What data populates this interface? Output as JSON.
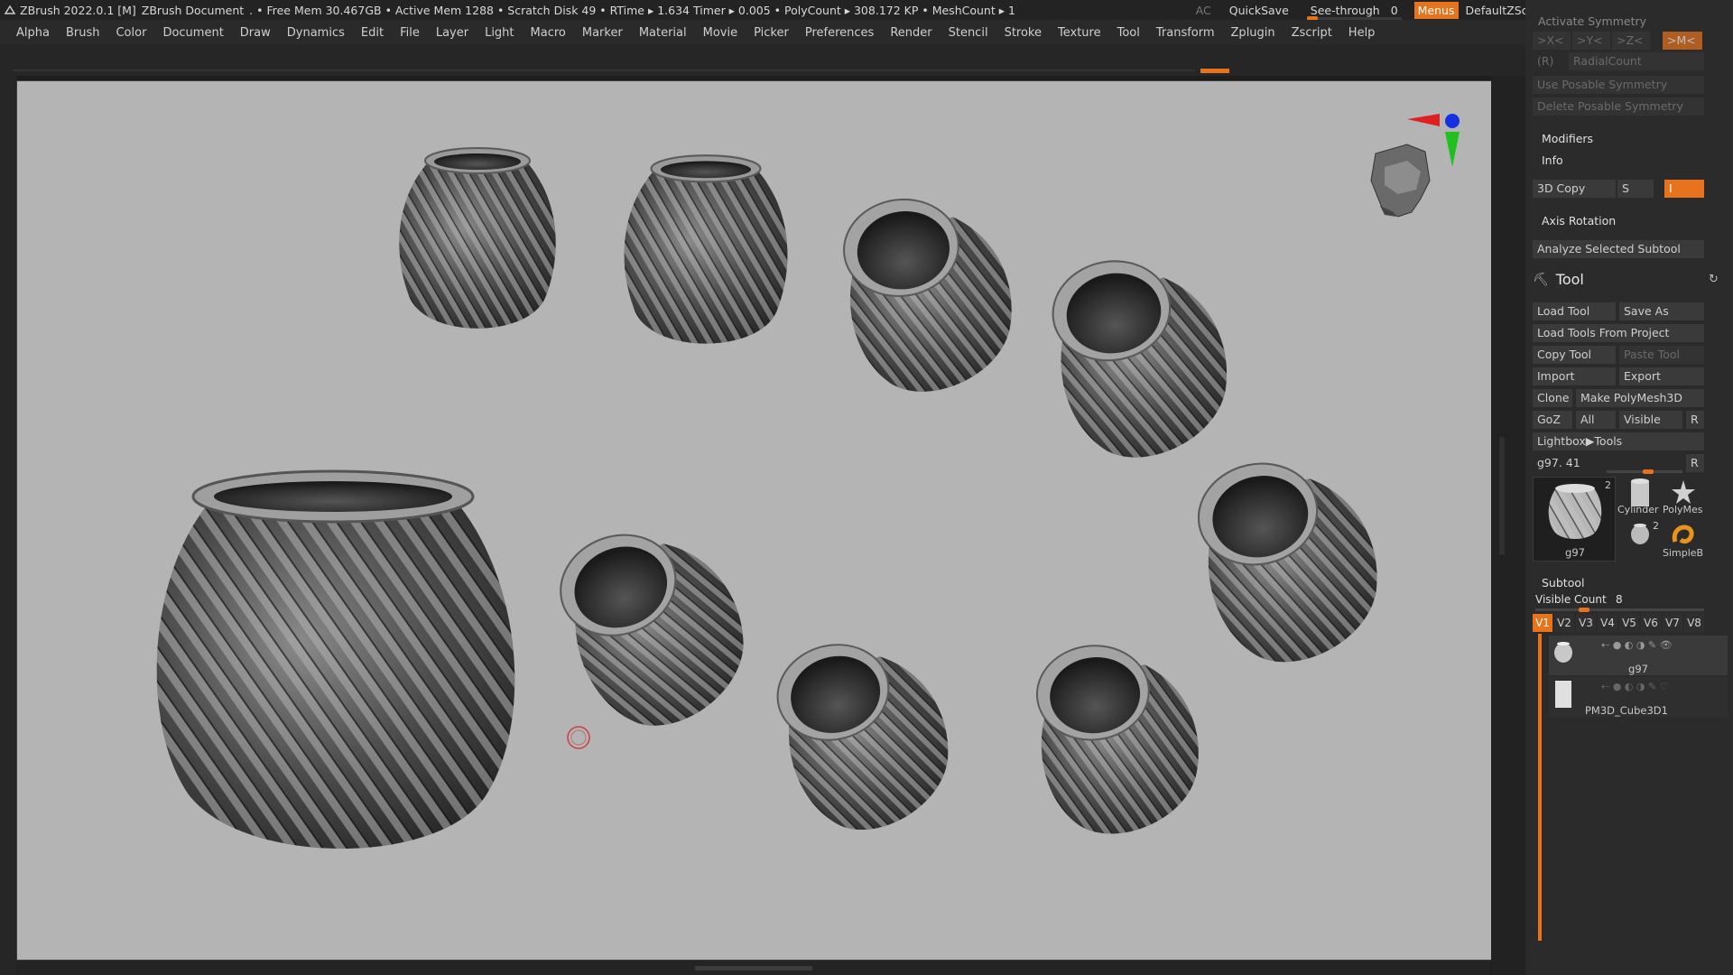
{
  "title": {
    "app": "ZBrush 2022.0.1 [M]",
    "document": "ZBrush Document",
    "stats": ". • Free Mem 30.467GB • Active Mem 1288 • Scratch Disk 49 • RTime ▸ 1.634 Timer ▸ 0.005 • PolyCount ▸ 308.172 KP • MeshCount ▸ 1"
  },
  "topright": {
    "ac": "AC",
    "quicksave": "QuickSave",
    "seethrough": "See-through",
    "seethrough_value": "0",
    "menus": "Menus",
    "zscript": "DefaultZScript"
  },
  "menu": [
    "Alpha",
    "Brush",
    "Color",
    "Document",
    "Draw",
    "Dynamics",
    "Edit",
    "File",
    "Layer",
    "Light",
    "Macro",
    "Marker",
    "Material",
    "Movie",
    "Picker",
    "Preferences",
    "Render",
    "Stencil",
    "Stroke",
    "Texture",
    "Tool",
    "Transform",
    "Zplugin",
    "Zscript",
    "Help"
  ],
  "panel": {
    "activate_symmetry": "Activate Symmetry",
    "sym_x": ">X<",
    "sym_y": ">Y<",
    "sym_z": ">Z<",
    "sym_m": ">M<",
    "r_label": "(R)",
    "radial_count": "RadialCount",
    "use_posable": "Use Posable Symmetry",
    "delete_posable": "Delete Posable Symmetry",
    "modifiers": "Modifiers",
    "info": "Info",
    "copy3d": "3D Copy",
    "copy3d_s": "S",
    "copy3d_i": "I",
    "axis_rotation": "Axis Rotation",
    "analyze": "Analyze Selected Subtool",
    "tool_title": "Tool",
    "load_tool": "Load Tool",
    "save_as": "Save As",
    "load_from_project": "Load Tools From Project",
    "copy_tool": "Copy Tool",
    "paste_tool": "Paste Tool",
    "import": "Import",
    "export": "Export",
    "clone": "Clone",
    "make_polymesh": "Make PolyMesh3D",
    "goz": "GoZ",
    "all": "All",
    "visible": "Visible",
    "r": "R",
    "lightbox_tools": "Lightbox▶Tools",
    "current_tool": "g97. 41",
    "thumb_main_label": "g97",
    "thumb_main_count": "2",
    "thumb_cyl": "Cylinder",
    "thumb_poly": "PolyMes",
    "thumb_small": "g97",
    "thumb_small_count": "2",
    "thumb_simple": "SimpleB",
    "subtool": "Subtool",
    "visible_count_label": "Visible Count",
    "visible_count": "8",
    "vtabs": [
      "V1",
      "V2",
      "V3",
      "V4",
      "V5",
      "V6",
      "V7",
      "V8"
    ],
    "subtool1": "g97",
    "subtool2": "PM3D_Cube3D1"
  },
  "colors": {
    "accent": "#e7731c",
    "viewport_bg": "#b4b4b4",
    "panel_bg": "#2b2b2b"
  }
}
